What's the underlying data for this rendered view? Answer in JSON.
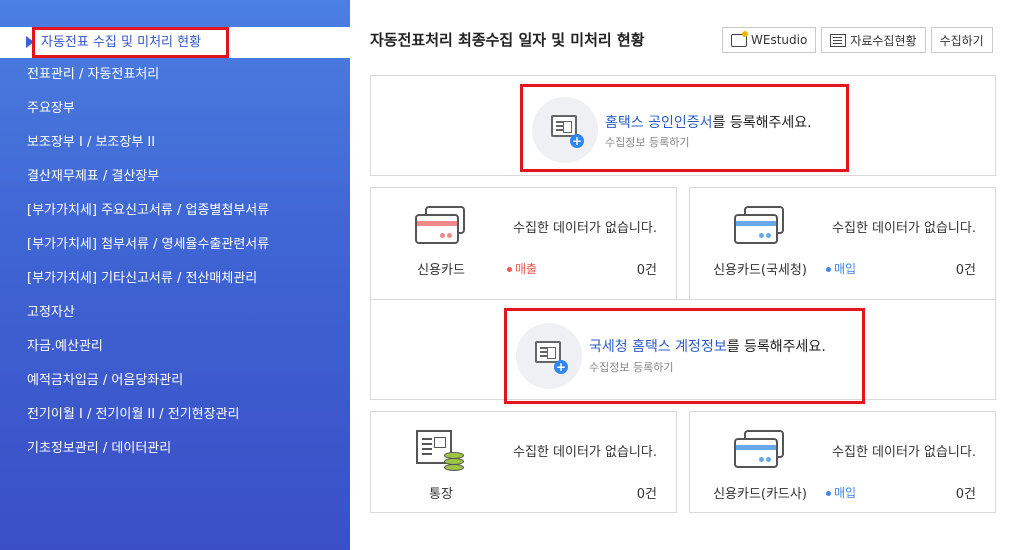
{
  "sidebar": {
    "active_item": "자동전표 수집 및 미처리 현황",
    "items": [
      "전표관리 / 자동전표처리",
      "주요장부",
      "보조장부 I / 보조장부 II",
      "결산재무제표 / 결산장부",
      "[부가가치세] 주요신고서류 / 업종별첨부서류",
      "[부가가치세] 첨부서류 / 영세율수출관련서류",
      "[부가가치세] 기타신고서류 / 전산매체관리",
      "고정자산",
      "자금.예산관리",
      "예적금차입금 / 어음당좌관리",
      "전기이월 I / 전기이월 II / 전기현장관리",
      "기초정보관리 / 데이터관리"
    ]
  },
  "main": {
    "title": "자동전표처리 최종수집 일자 및 미처리 현황",
    "toolbar": {
      "westudio": "WEstudio",
      "data_status": "자료수집현황",
      "collect": "수집하기"
    },
    "hometax_cert": {
      "accent": "홈택스 공인인증서",
      "rest": "를 등록해주세요.",
      "sub": "수집정보 등록하기"
    },
    "hometax_account": {
      "accent": "국세청 홈택스 계정정보",
      "rest": "를 등록해주세요.",
      "sub": "수집정보 등록하기"
    },
    "cards": [
      {
        "name": "신용카드",
        "message": "수집한 데이터가 없습니다.",
        "tag": "매출",
        "count": "0건"
      },
      {
        "name": "신용카드(국세청)",
        "message": "수집한 데이터가 없습니다.",
        "tag": "매입",
        "count": "0건"
      },
      {
        "name": "통장",
        "message": "수집한 데이터가 없습니다.",
        "tag": "",
        "count": "0건"
      },
      {
        "name": "신용카드(카드사)",
        "message": "수집한 데이터가 없습니다.",
        "tag": "매입",
        "count": "0건"
      }
    ]
  },
  "colors": {
    "sidebar_top": "#4b7fe0",
    "sidebar_bottom": "#3a4fc6",
    "highlight": "#e4141e",
    "accent_text": "#2b5dc8"
  }
}
